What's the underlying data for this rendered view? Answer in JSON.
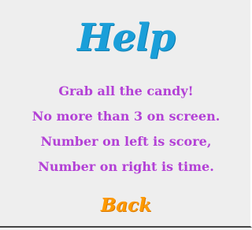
{
  "screen": {
    "title": "Help",
    "lines": [
      "Grab all the candy!",
      "No more than 3 on screen.",
      "Number on left is score,",
      "Number on right is time."
    ],
    "back_label": "Back"
  },
  "colors": {
    "background": "#eeeeee",
    "title": "#1a9fd9",
    "text": "#b341d6",
    "back": "#ff9a00"
  }
}
